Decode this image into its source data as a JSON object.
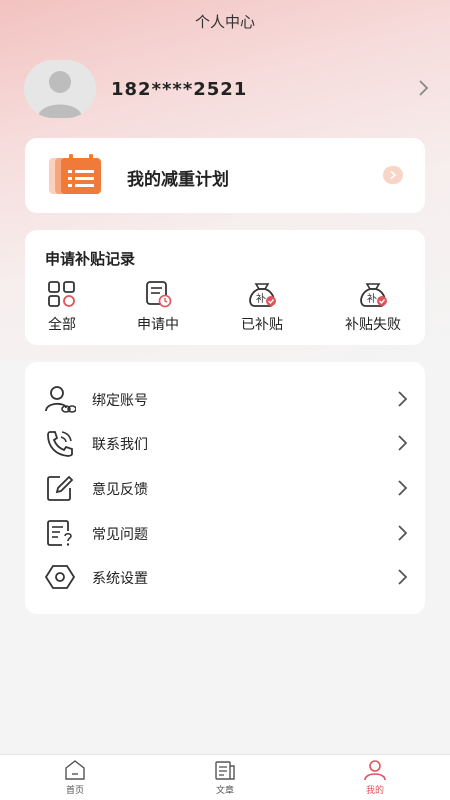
{
  "header": {
    "title": "个人中心"
  },
  "profile": {
    "phone": "182****2521"
  },
  "plan": {
    "label": "我的减重计划"
  },
  "subsidy": {
    "title": "申请补贴记录",
    "items": [
      {
        "label": "全部",
        "icon": "grid-icon"
      },
      {
        "label": "申请中",
        "icon": "document-clock-icon"
      },
      {
        "label": "已补贴",
        "icon": "money-bag-check-icon"
      },
      {
        "label": "补贴失败",
        "icon": "money-bag-check-icon"
      }
    ],
    "bag_glyph": "补"
  },
  "menu": {
    "items": [
      {
        "label": "绑定账号",
        "icon": "user-link-icon"
      },
      {
        "label": "联系我们",
        "icon": "phone-icon"
      },
      {
        "label": "意见反馈",
        "icon": "edit-icon"
      },
      {
        "label": "常见问题",
        "icon": "faq-icon"
      },
      {
        "label": "系统设置",
        "icon": "settings-icon"
      }
    ]
  },
  "tabbar": {
    "items": [
      {
        "label": "首页",
        "icon": "home-icon",
        "active": false
      },
      {
        "label": "文章",
        "icon": "article-icon",
        "active": false
      },
      {
        "label": "我的",
        "icon": "user-icon",
        "active": true
      }
    ]
  },
  "colors": {
    "accent": "#e0545d",
    "plan_orange": "#f07a3a",
    "background": "#f4f4f4"
  }
}
